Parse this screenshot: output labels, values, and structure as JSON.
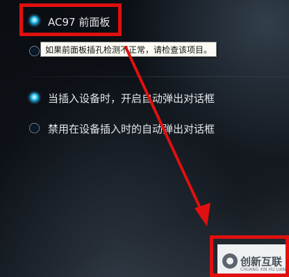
{
  "options": {
    "ac97_label": "AC97 前面板",
    "tooltip_text": "如果前面板插孔检测不正常，请检查该项目。",
    "auto_popup_label": "当插入设备时，开启自动弹出对话框",
    "disable_popup_label": "禁用在设备插入时的自动弹出对话框",
    "ac97_selected": true,
    "second_option_selected": false,
    "auto_popup_selected": true,
    "disable_popup_selected": false
  },
  "annotation": {
    "color": "#e01010"
  },
  "watermark": {
    "brand": "创新互联",
    "sub": "CHUANG XIN HU LIAN"
  }
}
